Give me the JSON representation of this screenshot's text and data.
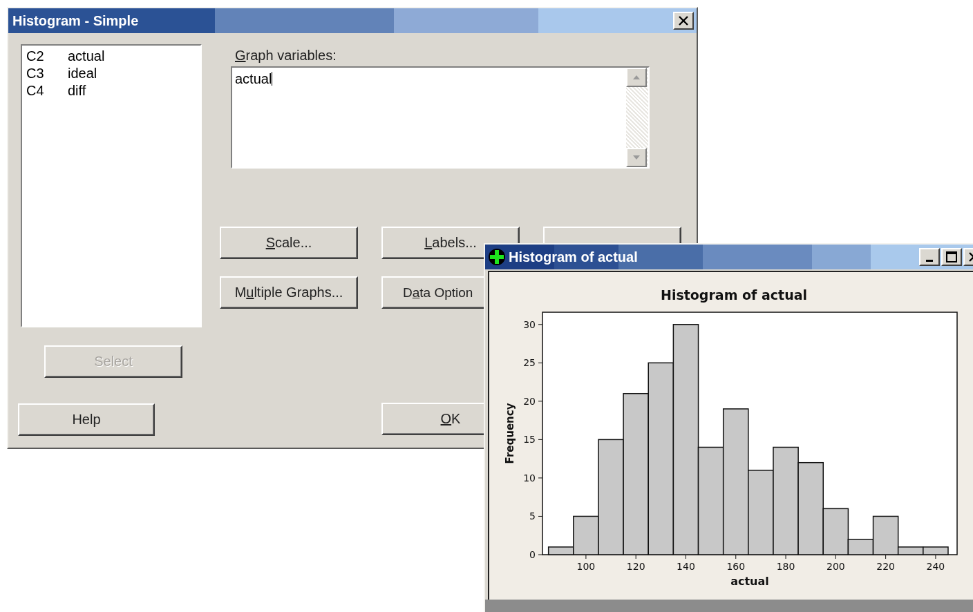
{
  "dialog": {
    "title": "Histogram - Simple",
    "variables": [
      {
        "column": "C2",
        "name": "actual"
      },
      {
        "column": "C3",
        "name": "ideal"
      },
      {
        "column": "C4",
        "name": "diff"
      }
    ],
    "graph_variables_label": {
      "key": "G",
      "post": "raph variables:"
    },
    "graph_variables_value": "actual",
    "buttons": [
      {
        "kind": "text",
        "key": "S",
        "post": "cale..."
      },
      {
        "kind": "text",
        "key": "L",
        "post": "abels..."
      },
      {
        "kind": "covered"
      },
      {
        "kind": "text",
        "pre": "M",
        "key": "u",
        "post": "ltiple Graphs..."
      },
      {
        "kind": "clipped",
        "pre": "D",
        "key": "a",
        "post": "ta Option"
      }
    ],
    "select_button": {
      "pre": "Select",
      "disabled": true
    },
    "help_button": {
      "pre": "Help",
      "disabled": false
    },
    "ok_button": {
      "key": "O",
      "post": "K",
      "disabled": false
    }
  },
  "graph_window": {
    "title": "Histogram of actual",
    "chart_data": {
      "type": "bar",
      "title": "Histogram of actual",
      "xlabel": "actual",
      "ylabel": "Frequency",
      "x": [
        90,
        100,
        110,
        120,
        130,
        140,
        150,
        160,
        170,
        180,
        190,
        200,
        210,
        220,
        230,
        240
      ],
      "series": [
        {
          "color": "#c8c8c8",
          "values": [
            1,
            5,
            15,
            21,
            25,
            30,
            14,
            19,
            11,
            14,
            12,
            6,
            2,
            5,
            1,
            1
          ]
        }
      ],
      "xlim": [
        82.6,
        248.6
      ],
      "ylim": [
        0,
        31.6
      ],
      "xticks": [
        100,
        120,
        140,
        160,
        180,
        200,
        220,
        240
      ],
      "yticks": [
        0,
        5,
        10,
        15,
        20,
        25,
        30
      ]
    }
  }
}
